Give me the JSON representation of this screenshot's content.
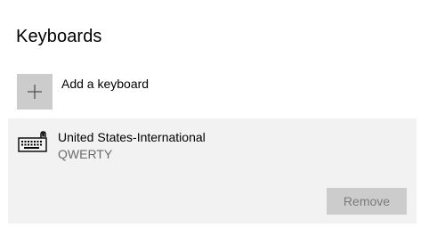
{
  "section": {
    "title": "Keyboards"
  },
  "add_keyboard": {
    "label": "Add a keyboard",
    "icon": "plus-icon"
  },
  "keyboards": [
    {
      "name": "United States-International",
      "layout": "QWERTY",
      "icon": "keyboard-icon",
      "remove_label": "Remove"
    }
  ]
}
